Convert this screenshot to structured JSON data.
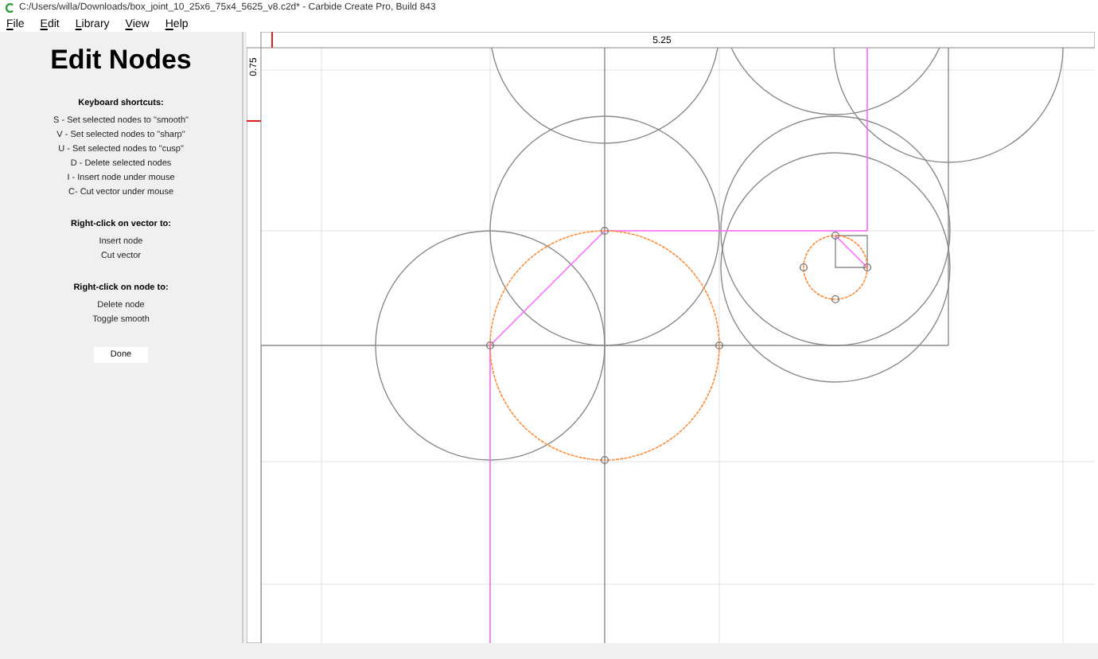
{
  "window": {
    "title": "C:/Users/willa/Downloads/box_joint_10_25x6_75x4_5625_v8.c2d* - Carbide Create Pro, Build 843"
  },
  "menu": [
    {
      "label": "File"
    },
    {
      "label": "Edit"
    },
    {
      "label": "Library"
    },
    {
      "label": "View"
    },
    {
      "label": "Help"
    }
  ],
  "panel": {
    "title": "Edit Nodes",
    "sections": [
      {
        "heading": "Keyboard shortcuts:",
        "items": [
          "S - Set selected nodes to \"smooth\"",
          "V - Set selected nodes to \"sharp\"",
          "U - Set selected nodes to \"cusp\"",
          "D - Delete selected nodes",
          "I - Insert node under mouse",
          "C- Cut vector under mouse"
        ]
      },
      {
        "heading": "Right-click on vector to:",
        "items": [
          "Insert node",
          "Cut vector"
        ]
      },
      {
        "heading": "Right-click on node to:",
        "items": [
          "Delete node",
          "Toggle smooth"
        ]
      }
    ],
    "button": "Done"
  },
  "canvas": {
    "top_ruler_label": "5.25",
    "left_ruler_label": "0.75"
  }
}
